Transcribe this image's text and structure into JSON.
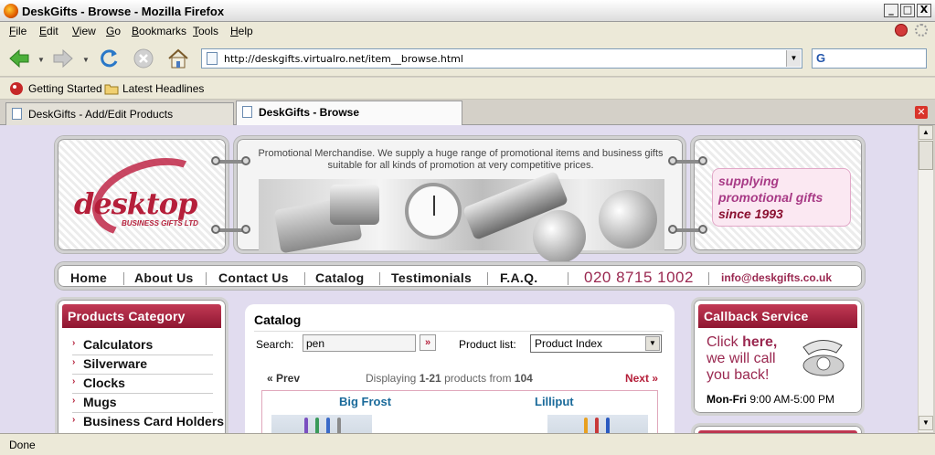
{
  "window": {
    "title": "DeskGifts - Browse - Mozilla Firefox",
    "min": "_",
    "max": "□",
    "close": "X"
  },
  "menu": [
    "File",
    "Edit",
    "View",
    "Go",
    "Bookmarks",
    "Tools",
    "Help"
  ],
  "menu_underline": [
    "F",
    "E",
    "V",
    "G",
    "B",
    "T",
    "H"
  ],
  "menu_rest": [
    "ile",
    "dit",
    "iew",
    "o",
    "ookmarks",
    "ools",
    "elp"
  ],
  "url": "http://deskgifts.virtualro.net/item__browse.html",
  "bookmarks": [
    "Getting Started",
    "Latest Headlines"
  ],
  "tabs": [
    {
      "label": "DeskGifts - Add/Edit Products"
    },
    {
      "label": "DeskGifts - Browse"
    }
  ],
  "status": "Done",
  "site": {
    "logo_text": "desktop",
    "logo_sub": "BUSINESS GIFTS LTD",
    "banner_text": "Promotional Merchandise. We supply a huge range of promotional items and business gifts suitable for all kinds of promotion at very competitive prices.",
    "slogan_1": "supplying",
    "slogan_2": "promotional gifts",
    "slogan_3": "since 1993",
    "nav": [
      "Home",
      "About Us",
      "Contact Us",
      "Catalog",
      "Testimonials",
      "F.A.Q."
    ],
    "phone": "020 8715 1002",
    "email": "info@deskgifts.co.uk"
  },
  "categories": {
    "title": "Products Category",
    "items": [
      "Calculators",
      "Silverware",
      "Clocks",
      "Mugs",
      "Business Card Holders"
    ]
  },
  "catalog": {
    "title": "Catalog",
    "search_label": "Search:",
    "search_value": "pen",
    "go": "»",
    "product_list_label": "Product list:",
    "product_list_value": "Product Index",
    "prev": "« Prev",
    "next": "Next »",
    "displaying": "Displaying",
    "range": "1-21",
    "products_from": "products from",
    "total": "104",
    "products": [
      "Big Frost",
      "Lilliput"
    ]
  },
  "callback": {
    "title": "Callback Service",
    "line1_a": "Click ",
    "line1_b": "here,",
    "line2": "we will call",
    "line3": "you back!",
    "days": "Mon-Fri",
    "hours": "9:00 AM-5:00 PM"
  }
}
